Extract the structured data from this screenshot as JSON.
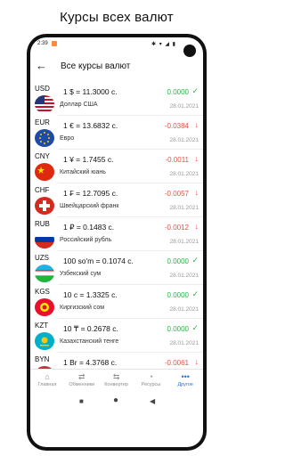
{
  "promo_title": "Курсы всех валют",
  "status": {
    "time": "2:39",
    "icons": "✱ ▾ ◢ ▮"
  },
  "header": {
    "title": "Все курсы валют"
  },
  "rates": [
    {
      "code": "USD",
      "rate": "1 $ = 11.3000 с.",
      "name": "Доллар США",
      "change": "0.0000",
      "trend": "up",
      "arrow": "✓",
      "date": "28.01.2021",
      "flag": "usd"
    },
    {
      "code": "EUR",
      "rate": "1 € = 13.6832 с.",
      "name": "Евро",
      "change": "-0.0384",
      "trend": "down",
      "arrow": "↓",
      "date": "28.01.2021",
      "flag": "eur"
    },
    {
      "code": "CNY",
      "rate": "1 ¥ = 1.7455 с.",
      "name": "Китайский юань",
      "change": "-0.0011",
      "trend": "down",
      "arrow": "↓",
      "date": "28.01.2021",
      "flag": "cny"
    },
    {
      "code": "CHF",
      "rate": "1 ₣ = 12.7095 с.",
      "name": "Швейцарский франк",
      "change": "-0.0057",
      "trend": "down",
      "arrow": "↓",
      "date": "28.01.2021",
      "flag": "chf"
    },
    {
      "code": "RUB",
      "rate": "1 ₽ = 0.1483 с.",
      "name": "Российский рубль",
      "change": "-0.0012",
      "trend": "down",
      "arrow": "↓",
      "date": "28.01.2021",
      "flag": "rub"
    },
    {
      "code": "UZS",
      "rate": "100 so'm = 0.1074 с.",
      "name": "Узбекский сум",
      "change": "0.0000",
      "trend": "up",
      "arrow": "✓",
      "date": "28.01.2021",
      "flag": "uzs"
    },
    {
      "code": "KGS",
      "rate": "10 с = 1.3325 с.",
      "name": "Киргизский сом",
      "change": "0.0000",
      "trend": "up",
      "arrow": "✓",
      "date": "28.01.2021",
      "flag": "kgs"
    },
    {
      "code": "KZT",
      "rate": "10 ₸ = 0.2678 с.",
      "name": "Казахстанский тенге",
      "change": "0.0000",
      "trend": "up",
      "arrow": "✓",
      "date": "28.01.2021",
      "flag": "kzt"
    },
    {
      "code": "BYN",
      "rate": "1 Br = 4.3768 с.",
      "name": "",
      "change": "-0.0061",
      "trend": "down",
      "arrow": "↓",
      "date": "",
      "flag": "byn"
    }
  ],
  "tabs": [
    {
      "label": "Главная",
      "icon": "⌂",
      "active": false
    },
    {
      "label": "Обменники",
      "icon": "⇄",
      "active": false
    },
    {
      "label": "Конвертер",
      "icon": "⇆",
      "active": false
    },
    {
      "label": "Ресурсы",
      "icon": "◔",
      "active": false
    },
    {
      "label": "Другое",
      "icon": "•••",
      "active": true
    }
  ],
  "colors": {
    "up": "#2db24a",
    "down": "#e0534a",
    "accent": "#2c73d2"
  }
}
